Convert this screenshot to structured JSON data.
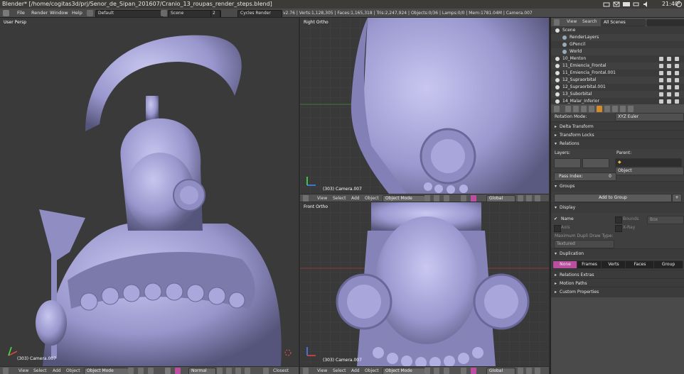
{
  "os_bar": {
    "window_title": "Blender* [/home/cogitas3d/prj/Senor_de_Sipan_201607/Cranio_13_roupas_render_steps.blend]",
    "clock": "21:40"
  },
  "info_header": {
    "menus": [
      "File",
      "Render",
      "Window",
      "Help"
    ],
    "screen_layout": "Default",
    "scene": "Scene",
    "scene_users": "2",
    "render_engine": "Cycles Render",
    "stats": "v2.76 | Verts:1,128,305 | Faces:1,165,318 | Tris:2,247,924 | Objects:0/36 | Lamps:0/0 | Mem:1781.04M | Camera.007"
  },
  "viewports": {
    "main": {
      "label": "User Persp",
      "camera": "(303) Camera.007"
    },
    "top_right": {
      "label": "Right Ortho",
      "camera": "(303) Camera.007"
    },
    "bottom_right": {
      "label": "Front Ortho",
      "camera": "(303) Camera.007"
    }
  },
  "viewport_header": {
    "menus": [
      "View",
      "Select",
      "Add",
      "Object"
    ],
    "mode": "Object Mode",
    "shading": "Normal",
    "orientation": "Global",
    "snap": "Closest"
  },
  "outliner": {
    "menus": [
      "View",
      "Search"
    ],
    "filter": "All Scenes",
    "items": [
      {
        "label": "Scene",
        "indent": 0
      },
      {
        "label": "RenderLayers",
        "indent": 1
      },
      {
        "label": "GPencil",
        "indent": 1
      },
      {
        "label": "World",
        "indent": 1
      },
      {
        "label": "10_Menton",
        "indent": 0
      },
      {
        "label": "11_Emiencia_Frontal",
        "indent": 0
      },
      {
        "label": "11_Emiencia_Frontal.001",
        "indent": 0
      },
      {
        "label": "12_Supraorbital",
        "indent": 0
      },
      {
        "label": "12_Supraorbital.001",
        "indent": 0
      },
      {
        "label": "13_Suborbital",
        "indent": 0
      },
      {
        "label": "14_Malar_Inferior",
        "indent": 0
      }
    ]
  },
  "properties": {
    "rotation_mode_label": "Rotation Mode:",
    "rotation_mode_value": "XYZ Euler",
    "delta_transform": "Delta Transform",
    "transform_locks": "Transform Locks",
    "relations": "Relations",
    "layers_label": "Layers:",
    "parent_label": "Parent:",
    "parent_type": "Object",
    "pass_index_label": "Pass Index:",
    "pass_index_value": "0",
    "groups": "Groups",
    "add_to_group": "Add to Group",
    "display": "Display",
    "name_label": "Name",
    "bounds_label": "Bounds",
    "bounds_type": "Box",
    "axis_label": "Axis",
    "xray_label": "X-Ray",
    "max_dupli_label": "Maximum Dupli Draw Type:",
    "max_dupli_value": "Textured",
    "duplication": "Duplication",
    "dup_tabs": [
      "None",
      "Frames",
      "Verts",
      "Faces",
      "Group"
    ],
    "relations_extras": "Relations Extras",
    "motion_paths": "Motion Paths",
    "custom_properties": "Custom Properties"
  },
  "colors": {
    "accent": "#bb4e9e",
    "sculpt": "#9a98cf",
    "viewport_bg": "#383838"
  }
}
